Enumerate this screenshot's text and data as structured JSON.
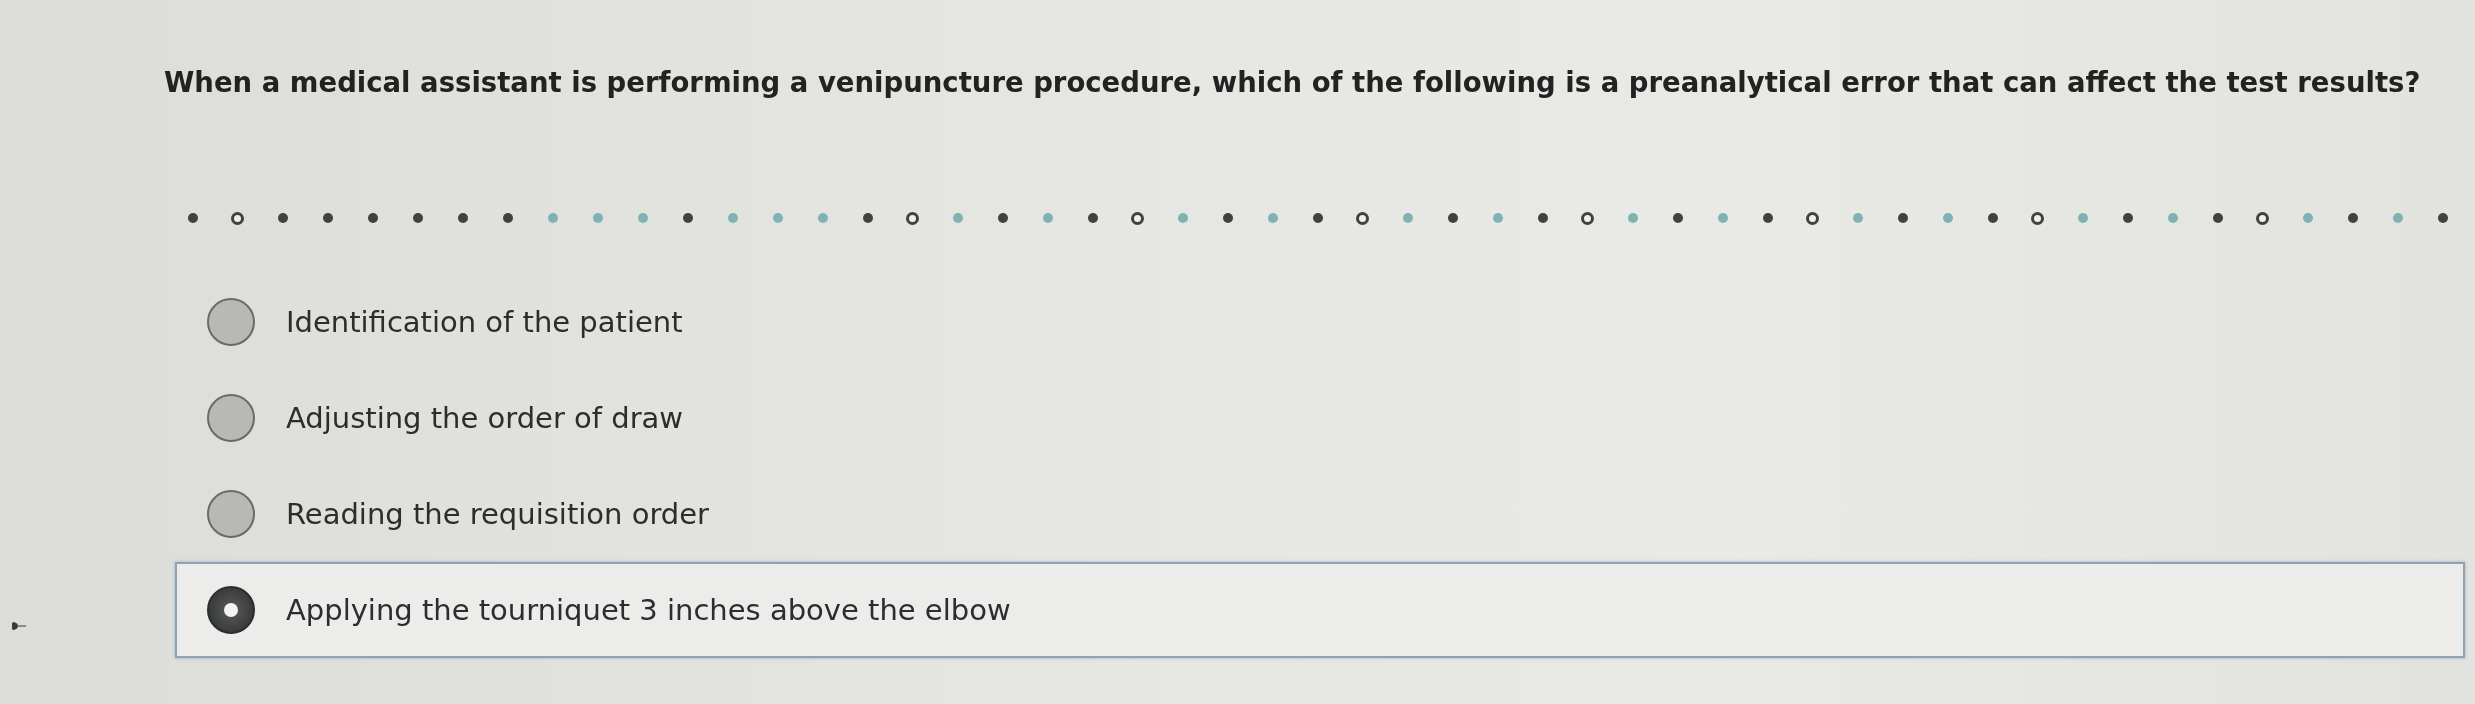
{
  "question": "When a medical assistant is performing a venipuncture procedure, which of the following is a preanalytical error that can affect the test results?",
  "progress_dots": [
    {
      "kind": "filled"
    },
    {
      "kind": "hollow"
    },
    {
      "kind": "filled"
    },
    {
      "kind": "filled"
    },
    {
      "kind": "filled"
    },
    {
      "kind": "filled"
    },
    {
      "kind": "filled"
    },
    {
      "kind": "filled"
    },
    {
      "kind": "tinted"
    },
    {
      "kind": "tinted"
    },
    {
      "kind": "tinted"
    },
    {
      "kind": "filled"
    },
    {
      "kind": "tinted"
    },
    {
      "kind": "tinted"
    },
    {
      "kind": "tinted"
    },
    {
      "kind": "filled"
    },
    {
      "kind": "hollow"
    },
    {
      "kind": "tinted"
    },
    {
      "kind": "filled"
    },
    {
      "kind": "tinted"
    },
    {
      "kind": "filled"
    },
    {
      "kind": "hollow"
    },
    {
      "kind": "tinted"
    },
    {
      "kind": "filled"
    },
    {
      "kind": "tinted"
    },
    {
      "kind": "filled"
    },
    {
      "kind": "hollow"
    },
    {
      "kind": "tinted"
    },
    {
      "kind": "filled"
    },
    {
      "kind": "tinted"
    },
    {
      "kind": "filled"
    },
    {
      "kind": "hollow"
    },
    {
      "kind": "tinted"
    },
    {
      "kind": "filled"
    },
    {
      "kind": "tinted"
    },
    {
      "kind": "filled"
    },
    {
      "kind": "hollow"
    },
    {
      "kind": "tinted"
    },
    {
      "kind": "filled"
    },
    {
      "kind": "tinted"
    },
    {
      "kind": "filled"
    },
    {
      "kind": "hollow"
    },
    {
      "kind": "tinted"
    },
    {
      "kind": "filled"
    },
    {
      "kind": "tinted"
    },
    {
      "kind": "filled"
    },
    {
      "kind": "hollow"
    },
    {
      "kind": "tinted"
    },
    {
      "kind": "filled"
    },
    {
      "kind": "tinted"
    },
    {
      "kind": "filled"
    }
  ],
  "options": [
    {
      "label": "Identification of the patient",
      "selected": false
    },
    {
      "label": "Adjusting the order of draw",
      "selected": false
    },
    {
      "label": "Reading the requisition order",
      "selected": false
    },
    {
      "label": "Applying the tourniquet 3 inches above the elbow",
      "selected": true
    }
  ]
}
